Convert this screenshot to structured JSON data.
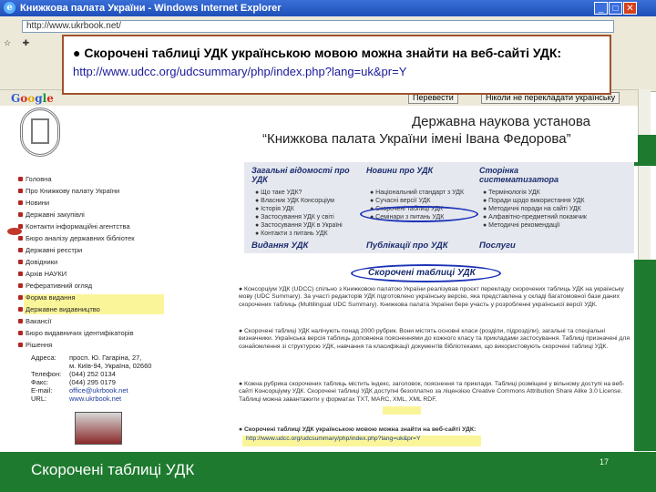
{
  "window": {
    "title": "Книжкова палата України - Windows Internet Explorer",
    "address": "http://www.ukrbook.net/"
  },
  "callout": {
    "line1": "Скорочені таблиці УДК українською мовою можна знайти на веб-сайті УДК:",
    "line2": "http://www.udcc.org/udcsummary/php/index.php?lang=uk&pr=Y"
  },
  "translate_bar": {
    "translate_button": "Перевести",
    "never_translate_button": "Ніколи не перекладати українську"
  },
  "header": {
    "line1": "Державна наукова установа",
    "line2": "“Книжкова палата України імені Івана Федорова”"
  },
  "sidebar": {
    "items": [
      "Головна",
      "Про Книжкову палату України",
      "Новини",
      "Державні закупівлі",
      "Контакти інформаційні агентства",
      "Бюро аналізу державних бібліотек",
      "Державні реєстри",
      "Довідники",
      "Архів НАУКИ",
      "Реферативний огляд",
      "Форма видання",
      "Державне видавництво",
      "Вакансії",
      "Бюро видавничих ідентифікаторів",
      "Рішення"
    ],
    "contact": {
      "address_label": "Адреса:",
      "address_value": "просп. Ю. Гагаріна, 27,",
      "address_value2": "м. Київ-94, Україна, 02660",
      "phone_label": "Телефон:",
      "phone_value": "(044) 252 0134",
      "fax_label": "Факс:",
      "fax_value": "(044) 295 0179",
      "email_label": "E-mail:",
      "email_value": "office@ukrbook.net",
      "url_label": "URL:",
      "url_value": "www.ukrbook.net"
    }
  },
  "menu": {
    "col1_title": "Загальні відомості про УДК",
    "col1_items": [
      "Що таке УДК?",
      "Власник УДК Консорціум",
      "Історія УДК",
      "Застосування УДК у світі",
      "Застосування УДК в Україні",
      "Контакти з питань УДК"
    ],
    "col2_title": "Новини про УДК",
    "col2_items": [
      "Національний стандарт з УДК",
      "Сучасні версії УДК",
      "Скорочені таблиці УДК",
      "Семінари з питань УДК"
    ],
    "col3_title": "Сторінка систематизатора",
    "col3_items": [
      "Термінологія УДК",
      "Поради щодо використання УДК",
      "Методичні поради на сайті УДК",
      "Алфавітно-предметний покажчик",
      "Методичні рекомендації"
    ],
    "bottom1": "Видання УДК",
    "bottom2": "Публікації про УДК",
    "bottom3": "Послуги"
  },
  "content": {
    "title": "Скорочені таблиці УДК",
    "p1": "Консорціум УДК (UDCC) спільно з Книжковою палатою України реалізував проєкт перекладу скорочених таблиць УДК на українську мову (UDC Summary). За участі редакторів УДК підготовлено українську версію, яка представлена у складі багатомовної бази даних скорочених таблиць (Multilingual UDC Summary). Книжкова палата України бере участь у розробленні української версії УДК.",
    "p2": "Скорочені таблиці УДК налічують понад 2000 рубрик. Вони містять основні класи (розділи, підрозділи), загальні та спеціальні визначники. Українська версія таблиць доповнена поясненнями до кожного класу та прикладами застосування. Таблиці призначені для ознайомлення зі структурою УДК, навчання та класифікації документів бібліотеками, що використовують скорочені таблиці УДК.",
    "p3": "Кожна рубрика скорочених таблиць містить індекс, заголовок, пояснення та приклади. Таблиці розміщені у вільному доступі на веб-сайті Консорціуму УДК. Скорочені таблиці УДК доступні безоплатно за ліцензією Creative Commons Attribution Share Alike 3.0 License. Таблиці можна завантажити у форматах TXT, MARC, XML, XML RDF.",
    "free_word": "безоплатно",
    "p4_title": "Скорочені таблиці УДК українською мовою можна знайти на веб-сайті УДК:",
    "p4_url": "http://www.udcc.org/udcsummary/php/index.php?lang=uk&pr=Y"
  },
  "slide": {
    "caption": "Скорочені таблиці   УДК",
    "number": "17"
  }
}
